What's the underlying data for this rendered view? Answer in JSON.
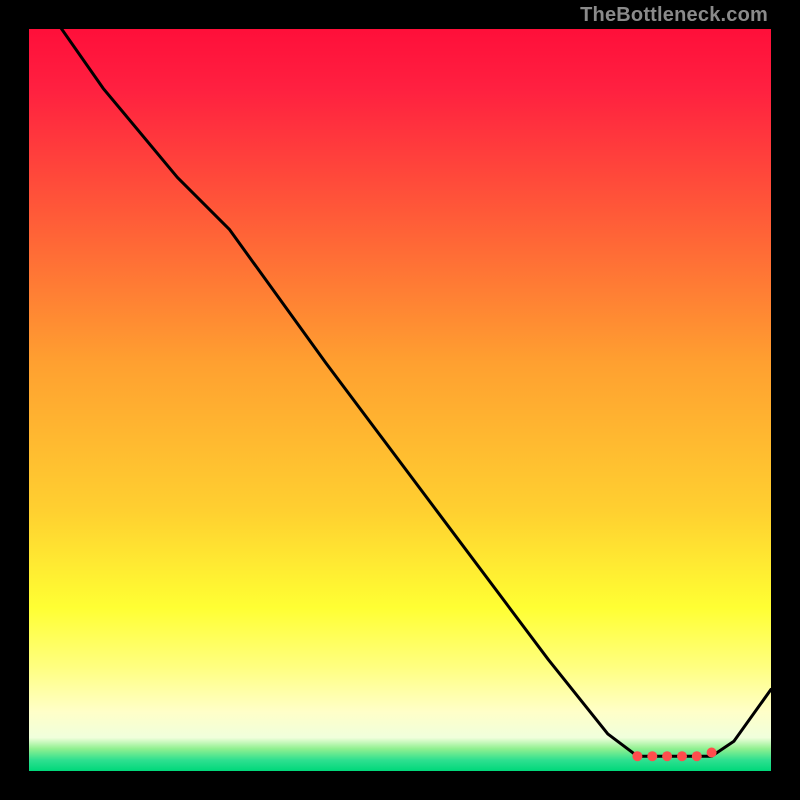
{
  "watermark": "TheBottleneck.com",
  "chart_data": {
    "type": "line",
    "title": "",
    "xlabel": "",
    "ylabel": "",
    "xlim": [
      0,
      100
    ],
    "ylim": [
      0,
      100
    ],
    "grid": false,
    "legend": false,
    "series": [
      {
        "name": "curve",
        "color": "#000000",
        "x": [
          3,
          10,
          20,
          27,
          40,
          55,
          70,
          78,
          82,
          88,
          92,
          95,
          100
        ],
        "values": [
          102,
          92,
          80,
          73,
          55,
          35,
          15,
          5,
          2,
          2,
          2,
          4,
          11
        ]
      }
    ],
    "markers": {
      "name": "highlight-range",
      "color": "#ff4d4d",
      "x": [
        82,
        84,
        86,
        88,
        90,
        92
      ],
      "values": [
        2,
        2,
        2,
        2,
        2,
        2.5
      ]
    },
    "gradient_stops": [
      {
        "offset": 0,
        "color": "#ff0f3a"
      },
      {
        "offset": 0.08,
        "color": "#ff2040"
      },
      {
        "offset": 0.25,
        "color": "#ff5a38"
      },
      {
        "offset": 0.45,
        "color": "#ffa030"
      },
      {
        "offset": 0.65,
        "color": "#ffd030"
      },
      {
        "offset": 0.78,
        "color": "#ffff33"
      },
      {
        "offset": 0.86,
        "color": "#ffff80"
      },
      {
        "offset": 0.92,
        "color": "#ffffc8"
      },
      {
        "offset": 0.955,
        "color": "#f0ffdc"
      },
      {
        "offset": 0.97,
        "color": "#90f090"
      },
      {
        "offset": 0.985,
        "color": "#30e090"
      },
      {
        "offset": 1.0,
        "color": "#00d87a"
      }
    ]
  }
}
